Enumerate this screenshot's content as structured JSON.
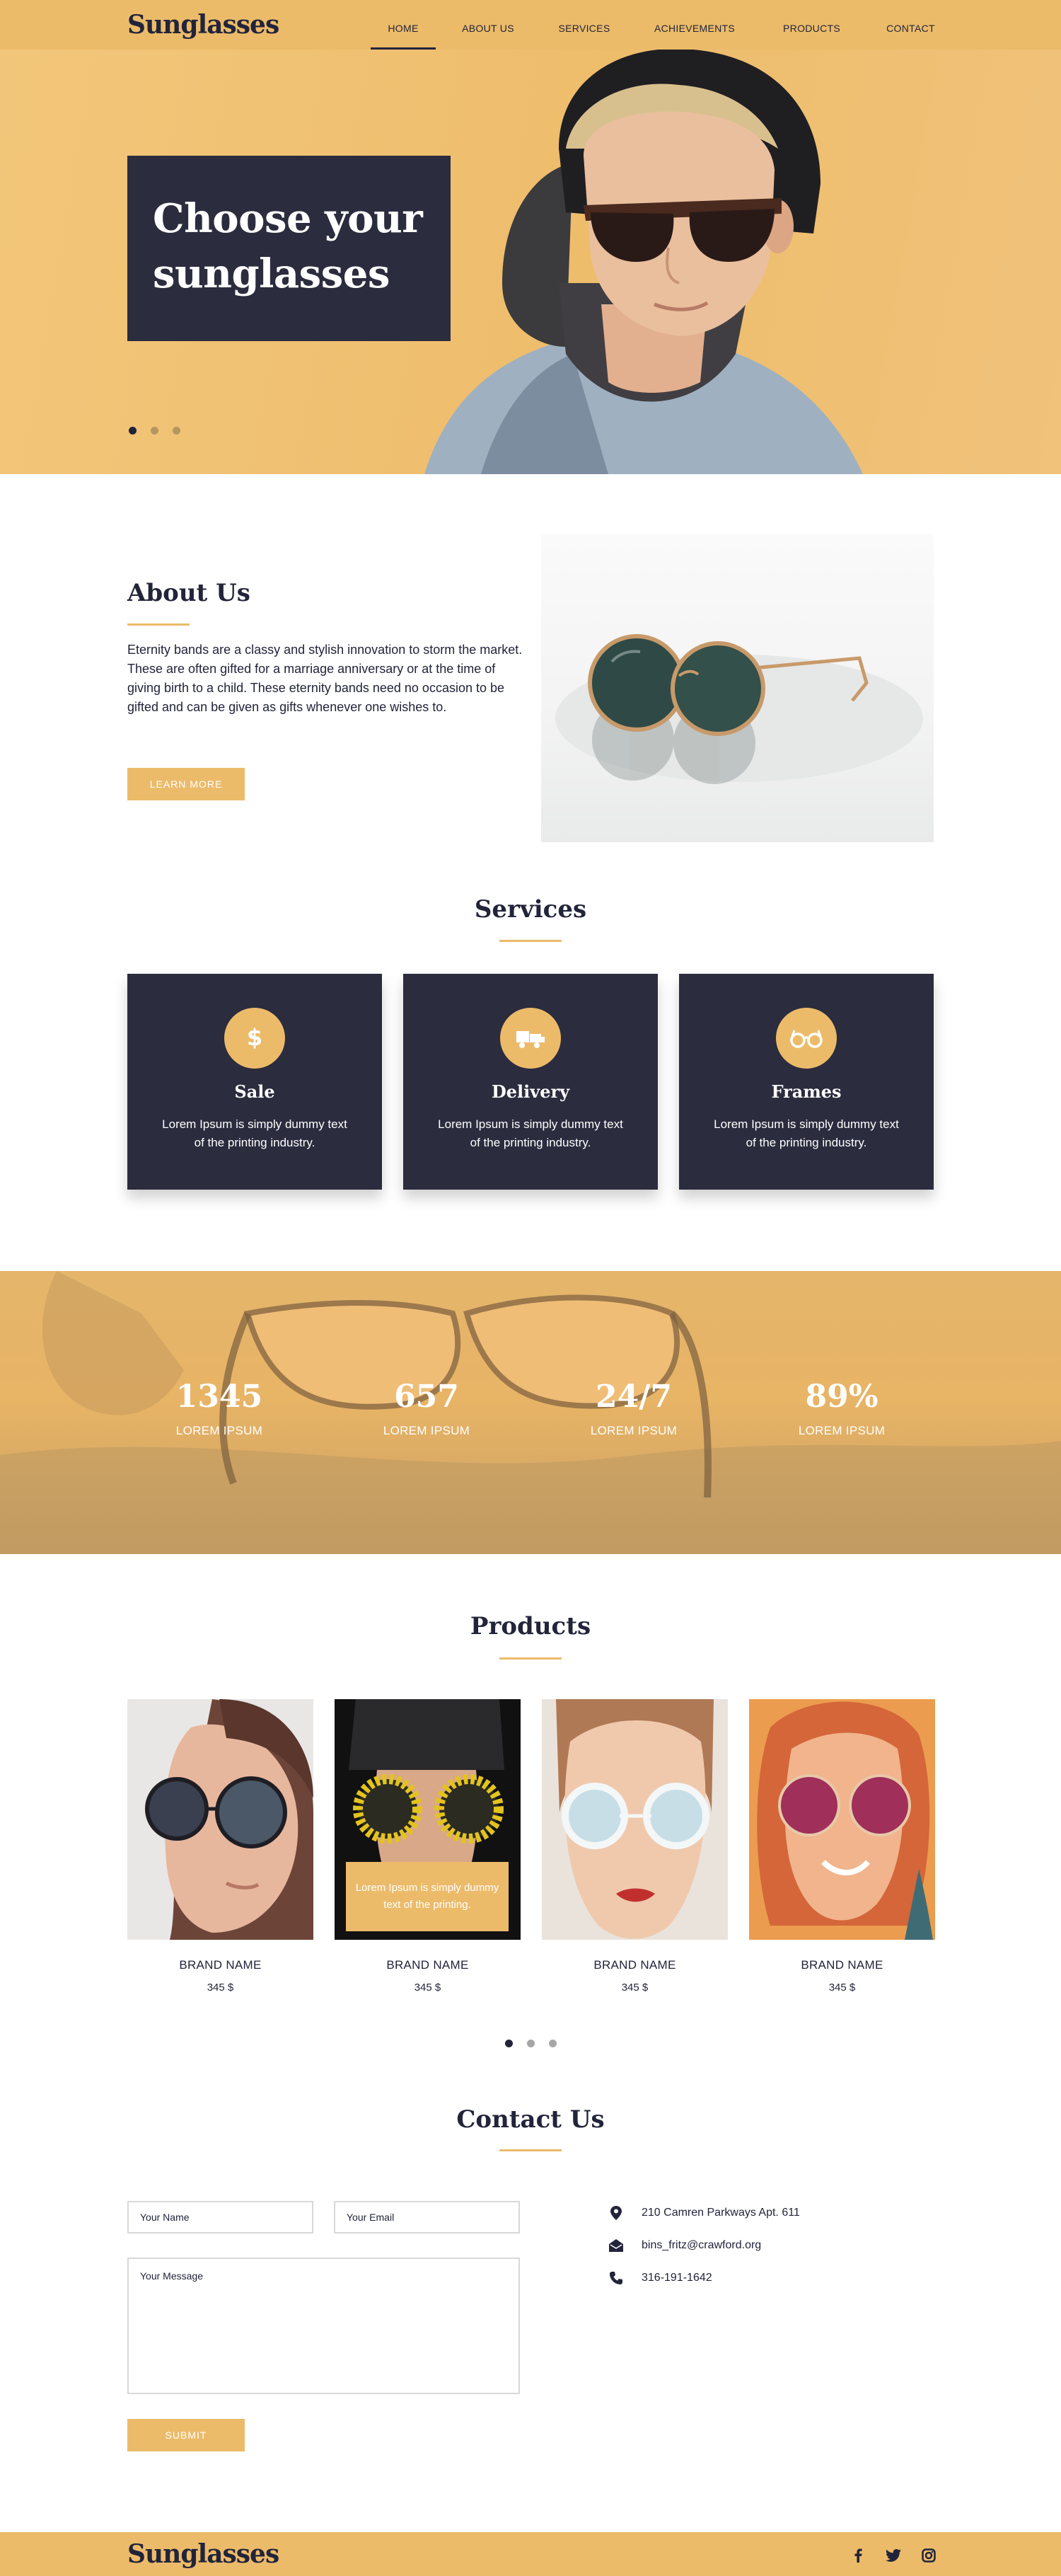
{
  "brand": "Sunglasses",
  "nav": [
    "HOME",
    "ABOUT US",
    "SERVICES",
    "ACHIEVEMENTS",
    "PRODUCTS",
    "CONTACT"
  ],
  "nav_active": "HOME",
  "hero": {
    "title_line1": "Choose your",
    "title_line2": "sunglasses",
    "slides": 3,
    "active_slide": 1
  },
  "about": {
    "title": "About Us",
    "text": "Eternity bands are a classy and stylish innovation to storm the market. These are often gifted for a marriage anniversary or at the time of giving birth to a child. These eternity bands need no occasion to be gifted and can be given as gifts whenever one wishes to.",
    "button": "LEARN MORE"
  },
  "services": {
    "title": "Services",
    "items": [
      {
        "title": "Sale",
        "text": "Lorem Ipsum is simply dummy text of the printing industry.",
        "icon": "dollar-icon"
      },
      {
        "title": "Delivery",
        "text": "Lorem Ipsum is simply dummy text of the printing industry.",
        "icon": "truck-icon"
      },
      {
        "title": "Frames",
        "text": "Lorem Ipsum is simply dummy text of the printing industry.",
        "icon": "glasses-icon"
      }
    ]
  },
  "stats": [
    {
      "value": "1345",
      "label": "LOREM IPSUM"
    },
    {
      "value": "657",
      "label": "LOREM IPSUM"
    },
    {
      "value": "24/7",
      "label": "LOREM IPSUM"
    },
    {
      "value": "89%",
      "label": "LOREM IPSUM"
    }
  ],
  "products": {
    "title": "Products",
    "items": [
      {
        "name": "BRAND NAME",
        "price": "345 $"
      },
      {
        "name": "BRAND NAME",
        "price": "345 $",
        "overlay": "Lorem Ipsum is simply dummy text of the printing."
      },
      {
        "name": "BRAND NAME",
        "price": "345 $"
      },
      {
        "name": "BRAND NAME",
        "price": "345 $"
      }
    ],
    "pages": 3,
    "active_page": 1
  },
  "contact": {
    "title": "Contact Us",
    "name_placeholder": "Your Name",
    "email_placeholder": "Your Email",
    "message_placeholder": "Your Message",
    "submit": "SUBMIT",
    "address": "210 Camren Parkways Apt. 611",
    "email": "bins_fritz@crawford.org",
    "phone": "316-191-1642"
  },
  "colors": {
    "accent": "#ecbb6a",
    "dark": "#2b2c3e",
    "text": "#22243a"
  }
}
